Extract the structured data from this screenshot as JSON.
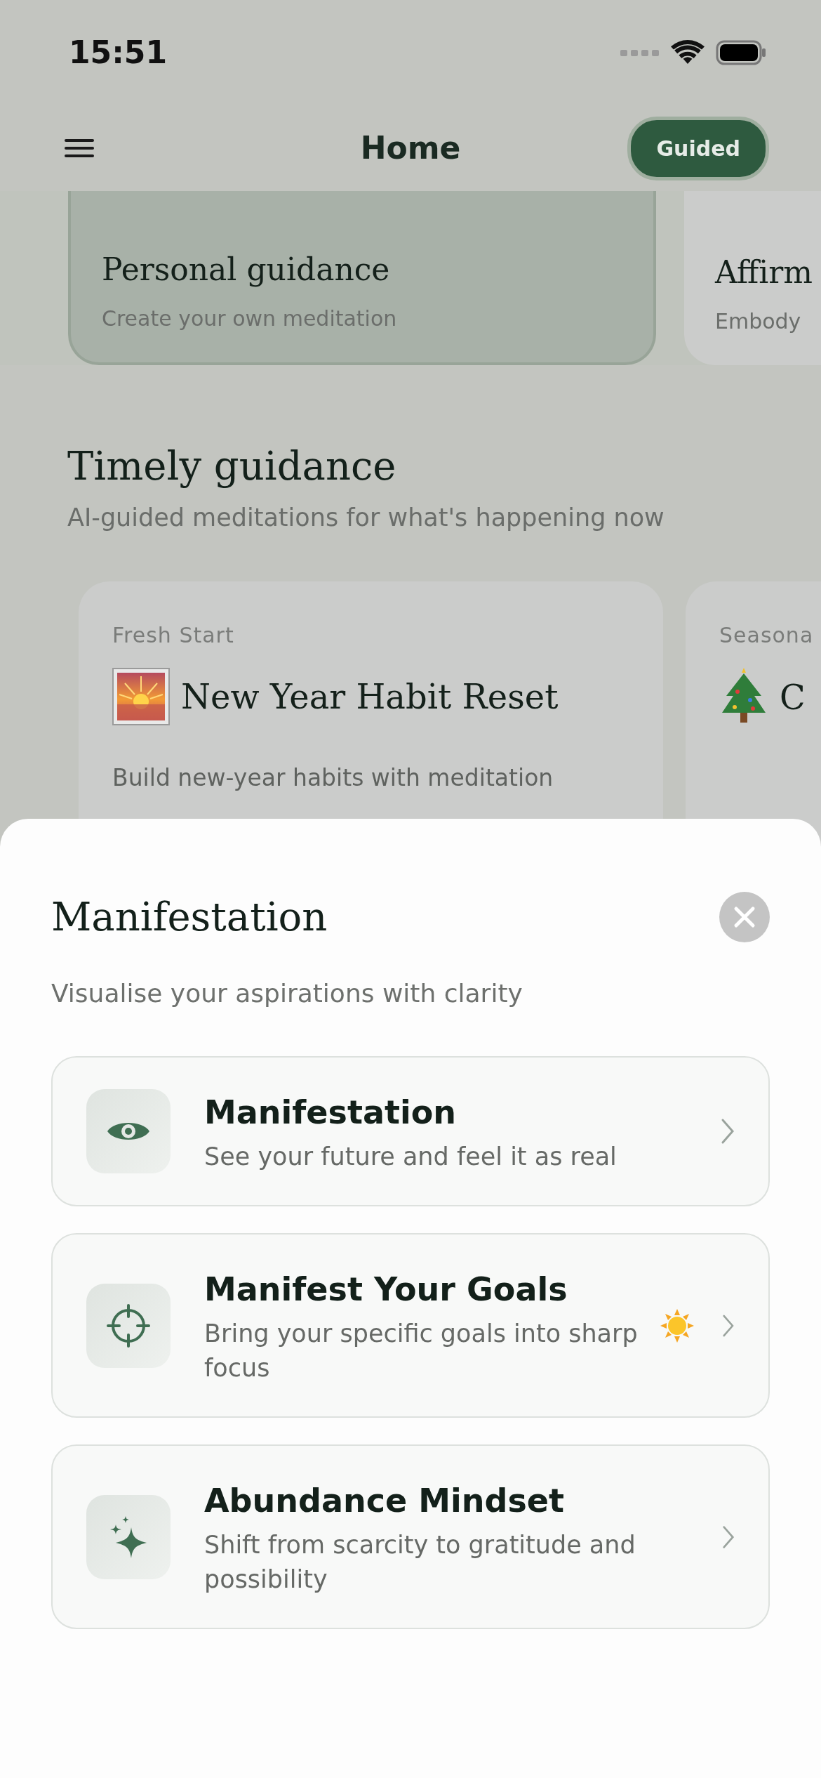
{
  "status_bar": {
    "time": "15:51"
  },
  "header": {
    "title": "Home",
    "mode_button": "Guided"
  },
  "feature_cards": [
    {
      "title": "Personal guidance",
      "subtitle": "Create your own meditation",
      "selected": true
    },
    {
      "title": "Affirm",
      "subtitle": "Embody",
      "selected": false
    }
  ],
  "timely": {
    "title": "Timely guidance",
    "subtitle": "AI-guided meditations for what's happening now",
    "cards": [
      {
        "category": "Fresh Start",
        "title": "New Year Habit Reset",
        "description": "Build new-year habits with meditation"
      },
      {
        "category": "Seasona",
        "title": "C"
      }
    ]
  },
  "sheet": {
    "title": "Manifestation",
    "subtitle": "Visualise your aspirations with clarity",
    "items": [
      {
        "title": "Manifestation",
        "description": "See your future and feel it as real"
      },
      {
        "title": "Manifest Your Goals",
        "description": "Bring your specific goals into sharp focus"
      },
      {
        "title": "Abundance Mindset",
        "description": "Shift from scarcity to gratitude and possibility"
      }
    ]
  }
}
